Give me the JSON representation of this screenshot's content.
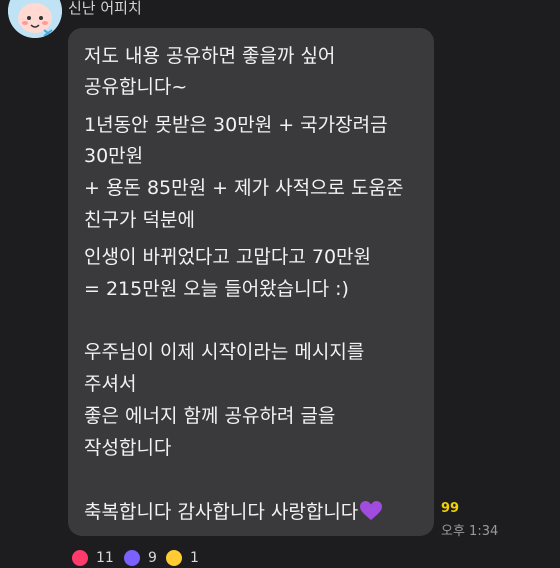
{
  "chat": {
    "sender_name": "신난 어피치",
    "message_lines": [
      "저도 내용 공유하면 좋을까 싶어",
      "공유합니다~",
      "1년동안 못받은 30만원 + 국가장려금",
      "30만원",
      "+ 용돈 85만원 + 제가 사적으로 도움준",
      "친구가 덕분에",
      "인생이 바뀌었다고 고맙다고 70만원",
      "= 215만원 오늘 들어왔습니다 :)",
      "",
      "우주님이 이제 시작이라는 메시지를",
      "주셔서",
      "좋은 에너지 함께 공유하려 글을",
      "작성합니다",
      "",
      "축복합니다 감사합니다 사랑합니다"
    ],
    "unread_count": "99",
    "time": "오후 1:34",
    "reactions": [
      {
        "icon": "heart-icon",
        "count": "11",
        "color": "#ff3b6b"
      },
      {
        "icon": "star-icon",
        "count": "9",
        "color": "#7b61ff"
      },
      {
        "icon": "smile-emoji-icon",
        "count": "1",
        "color": "#ffcc33"
      }
    ]
  },
  "colors": {
    "background": "#1d1d1f",
    "bubble": "#3a3a3d",
    "unread": "#f0d000"
  }
}
